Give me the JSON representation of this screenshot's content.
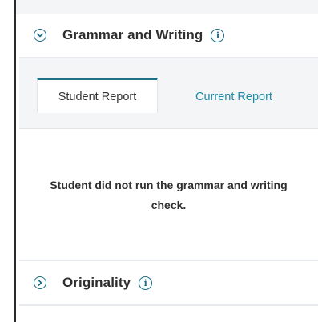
{
  "sections": {
    "grammar": {
      "title": "Grammar and Writing",
      "toggle_icon": "chevron-down-circle-icon",
      "info_icon": "info-circle-icon"
    },
    "originality": {
      "title": "Originality",
      "toggle_icon": "chevron-right-circle-icon",
      "info_icon": "info-circle-icon"
    }
  },
  "tabs": [
    {
      "label": "Student Report",
      "active": true
    },
    {
      "label": "Current Report",
      "active": false
    }
  ],
  "message": "Student did not run the grammar and writing check.",
  "colors": {
    "accent": "#1d7288",
    "link": "#1d8aa6",
    "text": "#2f2f2f",
    "panel_bg": "#f3f5f7",
    "divider": "#e7eaee"
  }
}
